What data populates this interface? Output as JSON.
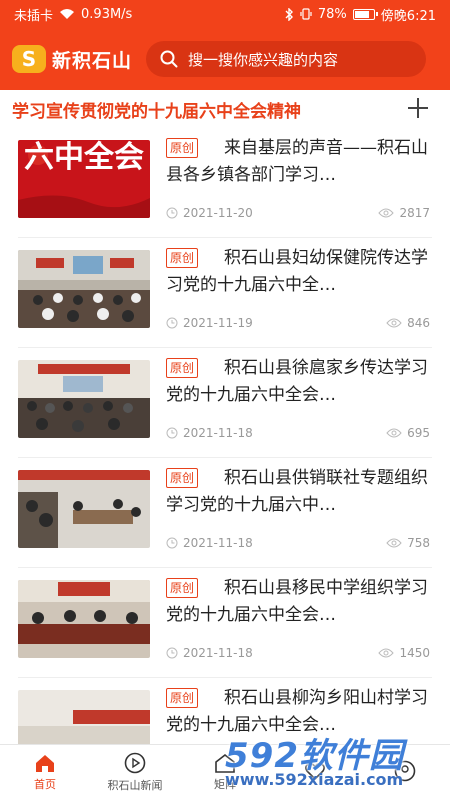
{
  "status_bar": {
    "left_text": "未插卡",
    "speed": "0.93M/s",
    "battery": "78%",
    "battery_level": 0.78,
    "time": "傍晚6:21"
  },
  "header": {
    "logo_letter": "S",
    "logo_text": "新积石山",
    "search_placeholder": "搜一搜你感兴趣的内容"
  },
  "topic": {
    "title": "学习宣传贯彻党的十九届六中全会精神"
  },
  "articles": [
    {
      "tag": "原创",
      "title": "来自基层的声音——积石山县各乡镇各部门学习…",
      "date": "2021-11-20",
      "views": "2817",
      "thumb_caption": "六中全会"
    },
    {
      "tag": "原创",
      "title": "积石山县妇幼保健院传达学习党的十九届六中全…",
      "date": "2021-11-19",
      "views": "846"
    },
    {
      "tag": "原创",
      "title": "积石山县徐扈家乡传达学习党的十九届六中全会…",
      "date": "2021-11-18",
      "views": "695"
    },
    {
      "tag": "原创",
      "title": "积石山县供销联社专题组织学习党的十九届六中…",
      "date": "2021-11-18",
      "views": "758"
    },
    {
      "tag": "原创",
      "title": "积石山县移民中学组织学习党的十九届六中全会…",
      "date": "2021-11-18",
      "views": "1450"
    },
    {
      "tag": "原创",
      "title": "积石山县柳沟乡阳山村学习党的十九届六中全会…",
      "date": "",
      "views": ""
    }
  ],
  "tabbar": {
    "tabs": [
      {
        "label": "首页"
      },
      {
        "label": "积石山新闻"
      },
      {
        "label": "矩阵"
      },
      {
        "label": ""
      },
      {
        "label": ""
      }
    ]
  },
  "watermark": {
    "brand": "592软件园",
    "url": "www.592xiazai.com"
  },
  "colors": {
    "brand": "#f2421a",
    "accent": "#e8411a",
    "logo": "#f7b01d"
  }
}
